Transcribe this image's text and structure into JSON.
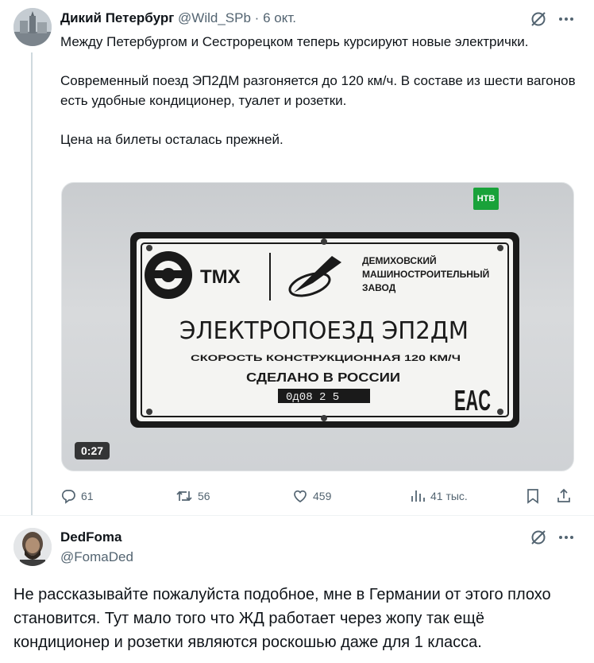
{
  "tweet1": {
    "author_name": "Дикий Петербург",
    "handle": "@Wild_SPb",
    "separator": "·",
    "time": "6 окт.",
    "paragraphs": [
      "Между Петербургом и Сестрорецком теперь курсируют новые электрички.",
      "Современный поезд ЭП2ДМ разгоняется до 120 км/ч. В составе из шести вагонов есть удобные кондиционер, туалет и розетки.",
      "Цена на билеты осталась прежней."
    ],
    "media": {
      "video_duration": "0:27",
      "channel_logo": "НТВ",
      "plate": {
        "brand": "ТМХ",
        "maker_lines": [
          "ДЕМИХОВСКИЙ",
          "МАШИНОСТРОИТЕЛЬНЫЙ",
          "ЗАВОД"
        ],
        "model": "ЭЛЕКТРОПОЕЗД ЭП2ДМ",
        "speed_line": "СКОРОСТЬ КОНСТРУКЦИОННАЯ 120 КМ/Ч",
        "made_in": "СДЕЛАНО В РОССИИ",
        "serial": "0д08 2 5",
        "cert_mark": "EAC"
      }
    },
    "stats": {
      "replies": "61",
      "retweets": "56",
      "likes": "459",
      "views": "41 тыс."
    }
  },
  "reply": {
    "author_name": "DedFoma",
    "handle": "@FomaDed",
    "text": "Не рассказывайте пожалуйста подобное, мне в Германии от этого плохо становится. Тут мало того что ЖД работает через жопу так ещё кондиционер и розетки являются роскошью даже для 1 класса."
  },
  "icons": [
    "grok-icon",
    "more-icon",
    "reply-icon",
    "retweet-icon",
    "like-icon",
    "views-icon",
    "bookmark-icon",
    "share-icon"
  ],
  "colors": {
    "text_primary": "#0f1419",
    "text_secondary": "#536471",
    "thread_line": "#cfd9de",
    "ntv_green": "#19a23a"
  }
}
